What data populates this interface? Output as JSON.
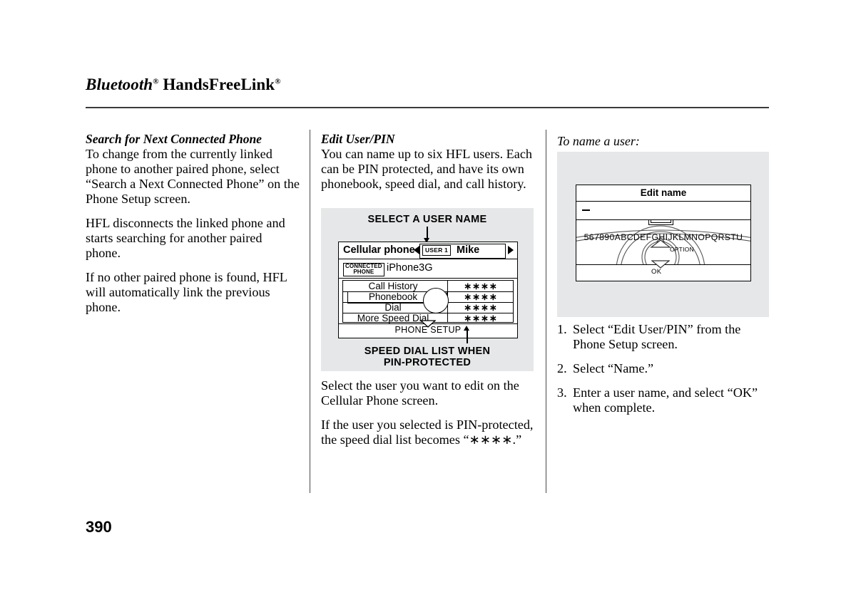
{
  "header": {
    "title_part1": "Bluetooth",
    "title_sup1": "®",
    "title_part2": "HandsFreeLink",
    "title_sup2": "®"
  },
  "page_number": "390",
  "column_left": {
    "heading": "Search for Next Connected Phone",
    "paragraphs": [
      "To change from the currently linked phone to another paired phone, select “Search a Next Connected Phone” on the Phone Setup screen.",
      "HFL disconnects the linked phone and starts searching for another paired phone.",
      "If no other paired phone is found, HFL will automatically link the previous phone."
    ]
  },
  "column_middle": {
    "heading": "Edit User/PIN",
    "intro": "You can name up to six HFL users. Each can be PIN protected, and have its own phonebook, speed dial, and call history.",
    "figure": {
      "caption_top": "SELECT A USER NAME",
      "caption_bottom_line1": "SPEED DIAL LIST WHEN",
      "caption_bottom_line2": "PIN-PROTECTED",
      "screen": {
        "title": "Cellular phone",
        "user_badge": "USER 1",
        "user_name": "Mike",
        "connected_badge_line1": "CONNECTED",
        "connected_badge_line2": "PHONE",
        "connected_phone": "iPhone3G",
        "list_items": [
          {
            "label": "Call History",
            "value": "∗∗∗∗",
            "selected": false
          },
          {
            "label": "Phonebook",
            "value": "∗∗∗∗",
            "selected": true
          },
          {
            "label": "Dial",
            "value": "∗∗∗∗",
            "selected": false
          },
          {
            "label": "More Speed Dial",
            "value": "∗∗∗∗",
            "selected": false
          }
        ],
        "footer": "PHONE SETUP"
      }
    },
    "paragraphs_after": [
      "Select the user you want to edit on the Cellular Phone screen.",
      "If the user you selected is PIN-protected, the speed dial list becomes “∗∗∗∗.”"
    ]
  },
  "column_right": {
    "heading": "To name a user:",
    "figure": {
      "screen": {
        "title": "Edit name",
        "entry_value": "–",
        "highlighted_char": "H",
        "alphabet": "567890ABCDEFGHIJKLMNOPQRSTU",
        "option_label": "OPTION",
        "ok_label": "OK"
      }
    },
    "steps": [
      {
        "num": "1.",
        "text": "Select “Edit User/PIN” from the Phone Setup screen."
      },
      {
        "num": "2.",
        "text": "Select “Name.”"
      },
      {
        "num": "3.",
        "text": "Enter a user name, and select “OK” when complete."
      }
    ]
  },
  "colors": {
    "figure_background": "#e6e7e8",
    "rule": "#3a3a3a",
    "text": "#000000"
  }
}
